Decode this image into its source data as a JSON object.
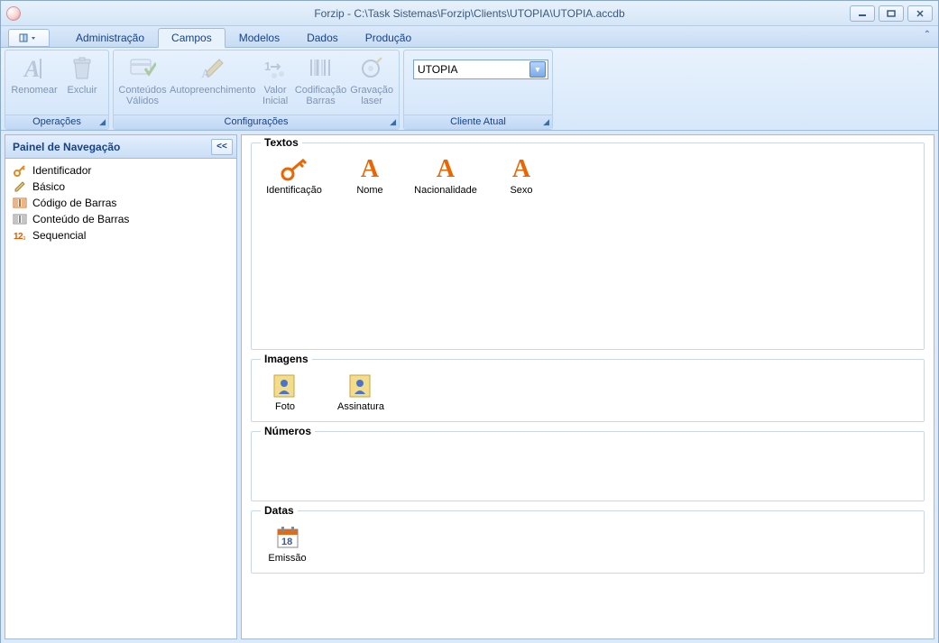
{
  "window": {
    "title": "Forzip - C:\\Task Sistemas\\Forzip\\Clients\\UTOPIA\\UTOPIA.accdb"
  },
  "tabs": {
    "app": "▢▾",
    "admin": "Administração",
    "campos": "Campos",
    "modelos": "Modelos",
    "dados": "Dados",
    "producao": "Produção"
  },
  "ribbon": {
    "operacoes": {
      "label": "Operações",
      "renomear": "Renomear",
      "excluir": "Excluir"
    },
    "config": {
      "label": "Configurações",
      "conteudos": "Conteúdos Válidos",
      "autopreench": "Autopreenchimento",
      "valor": "Valor Inicial",
      "codif": "Codificação Barras",
      "grav": "Gravação laser"
    },
    "cliente": {
      "label": "Cliente Atual",
      "value": "UTOPIA"
    }
  },
  "nav": {
    "title": "Painel de Navegação",
    "items": [
      {
        "label": "Identificador"
      },
      {
        "label": "Básico"
      },
      {
        "label": "Código de Barras"
      },
      {
        "label": "Conteúdo de Barras"
      },
      {
        "label": "Sequencial"
      }
    ]
  },
  "groups": {
    "textos": {
      "label": "Textos",
      "items": [
        {
          "label": "Identificação"
        },
        {
          "label": "Nome"
        },
        {
          "label": "Nacionalidade"
        },
        {
          "label": "Sexo"
        }
      ]
    },
    "imagens": {
      "label": "Imagens",
      "items": [
        {
          "label": "Foto"
        },
        {
          "label": "Assinatura"
        }
      ]
    },
    "numeros": {
      "label": "Números"
    },
    "datas": {
      "label": "Datas",
      "items": [
        {
          "label": "Emissão"
        }
      ]
    }
  }
}
